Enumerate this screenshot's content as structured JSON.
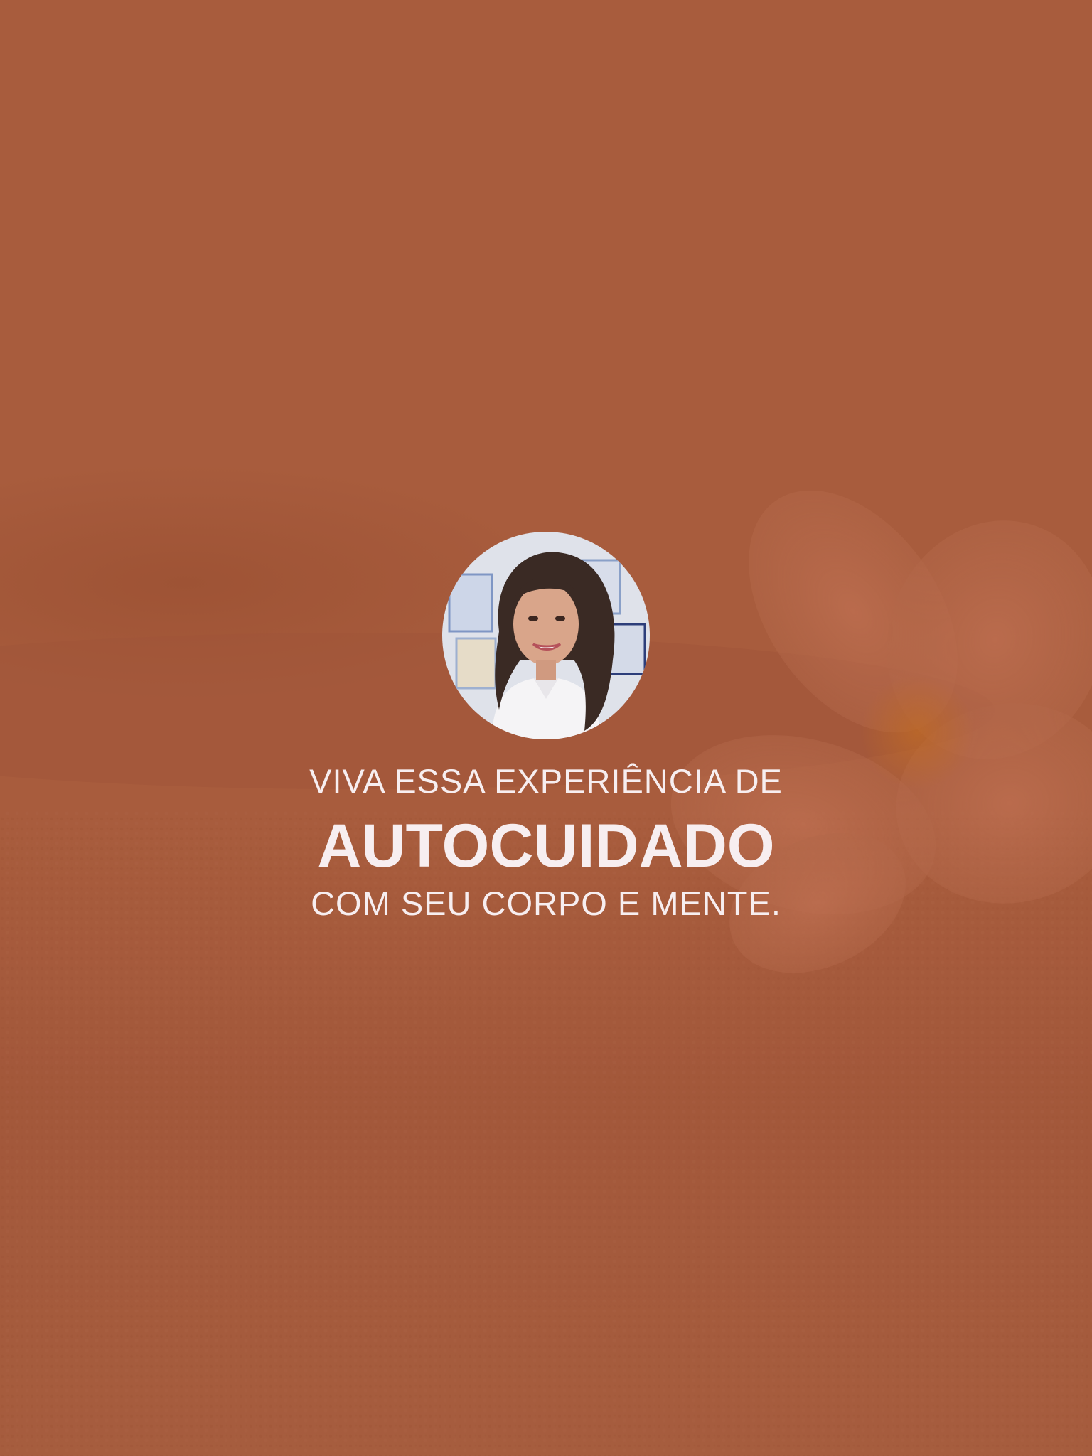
{
  "theme": {
    "background": "#a85c3d",
    "text_color": "#f7eef0"
  },
  "hero": {
    "photo_icon": "woman-portrait-photo",
    "decor_icon": "plumeria-flower-icon",
    "line_top": "VIVA ESSA EXPERIÊNCIA DE",
    "line_main": "AUTOCUIDADO",
    "line_bottom": "COM SEU CORPO E MENTE."
  }
}
